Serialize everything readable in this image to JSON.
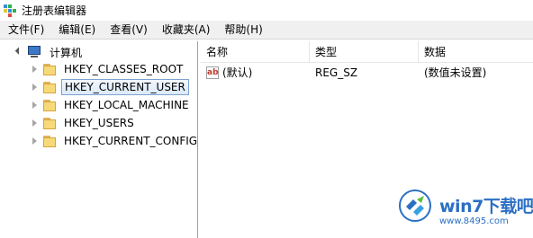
{
  "window": {
    "title": "注册表编辑器"
  },
  "menu": [
    "文件(F)",
    "编辑(E)",
    "查看(V)",
    "收藏夹(A)",
    "帮助(H)"
  ],
  "tree": {
    "root": "计算机",
    "items": [
      {
        "label": "HKEY_CLASSES_ROOT",
        "selected": false
      },
      {
        "label": "HKEY_CURRENT_USER",
        "selected": true
      },
      {
        "label": "HKEY_LOCAL_MACHINE",
        "selected": false
      },
      {
        "label": "HKEY_USERS",
        "selected": false
      },
      {
        "label": "HKEY_CURRENT_CONFIG",
        "selected": false
      }
    ]
  },
  "list": {
    "columns": [
      "名称",
      "类型",
      "数据"
    ],
    "rows": [
      {
        "icon": "ab",
        "name": "(默认)",
        "type": "REG_SZ",
        "data": "(数值未设置)"
      }
    ]
  },
  "watermark": {
    "title": "win7下载吧",
    "url": "www.8495.com"
  },
  "colors": {
    "selection_border": "#7da2ce",
    "folder": "#f7d979",
    "accent": "#2b6fc4"
  }
}
